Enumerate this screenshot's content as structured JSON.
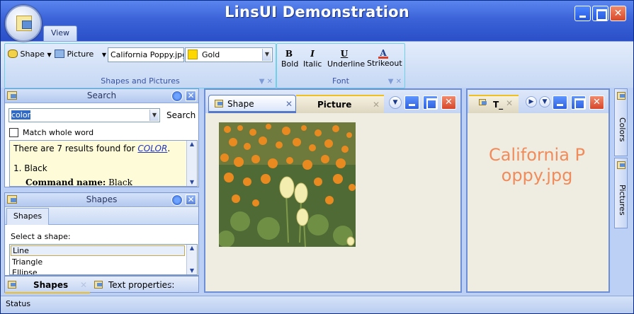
{
  "window": {
    "title": "LinsUI Demonstration",
    "close_glyph": "✕"
  },
  "ribbon": {
    "tab_view": "View",
    "groups": {
      "shapes_pictures": {
        "caption": "Shapes and Pictures",
        "shape_label": "Shape",
        "picture_label": "Picture",
        "file_value": "California Poppy.jpg",
        "color_value": "Gold"
      },
      "font": {
        "caption": "Font",
        "bold_label": "Bold",
        "italic_label": "Italic",
        "underline_label": "Underline",
        "strikeout_label": "Strikeout",
        "bold_icon": "B",
        "italic_icon": "I",
        "underline_icon": "U",
        "strikeout_icon": "A"
      },
      "group_tools_glyph": "▼ ✕"
    }
  },
  "search_panel": {
    "title": "Search",
    "query": "color",
    "search_button": "Search",
    "match_whole_word": "Match whole word",
    "result_prefix": "There are 7 results found for ",
    "result_term": "COLOR",
    "result_suffix": ".",
    "first_item": "1. Black",
    "command_name_label": "Command name:",
    "command_name_value": "Black"
  },
  "shapes_panel": {
    "title": "Shapes",
    "inner_tab": "Shapes",
    "prompt": "Select a shape:",
    "items": [
      "Line",
      "Triangle",
      "Ellipse"
    ],
    "bottom_tabs": [
      "Shapes",
      "Text properties:"
    ]
  },
  "documents": {
    "tabs": [
      "Shape",
      "Picture"
    ],
    "right_tab": "T_",
    "picture_caption": "California Poppy.jpg"
  },
  "side_tabs": [
    "Colors",
    "Pictures"
  ],
  "status": "Status",
  "colors": {
    "titlebar": "#3c63d8",
    "accent_cyan": "#6fd0e8",
    "picture_text": "#f08c5c",
    "gold": "#ffd700"
  }
}
